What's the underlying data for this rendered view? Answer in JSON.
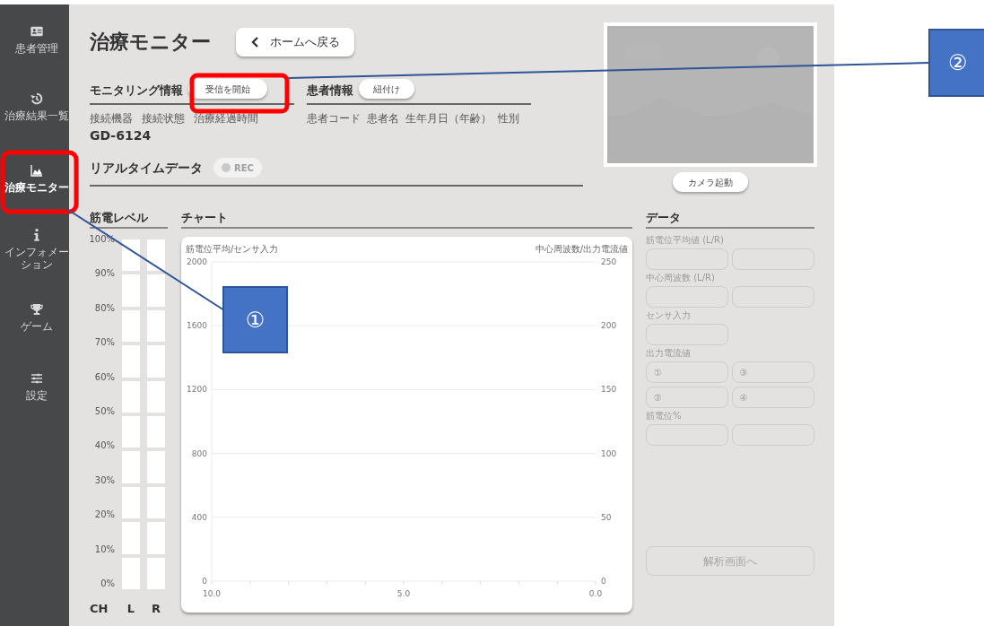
{
  "sidebar": {
    "items": [
      {
        "label": "患者管理",
        "selected": false
      },
      {
        "label": "治療結果一覧",
        "selected": false
      },
      {
        "label": "治療モニター",
        "selected": true
      },
      {
        "label": "インフォメーション",
        "selected": false
      },
      {
        "label": "ゲーム",
        "selected": false
      },
      {
        "label": "設定",
        "selected": false
      }
    ]
  },
  "header": {
    "title": "治療モニター",
    "back_button": "ホームへ戻る"
  },
  "monitoring": {
    "title": "モニタリング情報",
    "button": "受信を開始",
    "labels": [
      "接続機器",
      "接続状態",
      "治療経過時間"
    ],
    "device": "GD-6124"
  },
  "patient": {
    "title": "患者情報",
    "button": "紐付け",
    "labels": [
      "患者コード",
      "患者名",
      "生年月日（年齢）",
      "性別"
    ]
  },
  "realtime": {
    "title": "リアルタイムデータ",
    "rec_label": "REC",
    "recording": false
  },
  "camera": {
    "kind": "picture",
    "button": "カメラ起動"
  },
  "meter": {
    "title": "筋電レベル",
    "ticks": [
      "100%",
      "90%",
      "80%",
      "70%",
      "60%",
      "50%",
      "40%",
      "30%",
      "20%",
      "10%",
      "0%"
    ],
    "axis_label": "CH",
    "channels": [
      {
        "name": "L"
      },
      {
        "name": "R"
      }
    ]
  },
  "chart": {
    "title": "チャート",
    "right_axis": {
      "label": "中心周波数/出力電流値",
      "ticks": [
        "250",
        "200",
        "150",
        "100",
        "50",
        "0"
      ]
    },
    "chart_data": {
      "type": "line",
      "grid": true,
      "ylabel": "筋電位平均/センサ入力",
      "ylim": [
        0,
        2000
      ],
      "yticks": [
        0,
        400,
        800,
        1200,
        1600,
        2000
      ],
      "xlim": [
        10,
        0
      ],
      "xticks": [
        {
          "value": 10,
          "label": "10.0"
        },
        {
          "value": 5,
          "label": "5.0"
        },
        {
          "value": 0,
          "label": "0.0"
        }
      ]
    }
  },
  "data": {
    "title": "データ",
    "groups": [
      {
        "label": "筋電位平均値 (L/R)",
        "kind": "pair"
      },
      {
        "label": "中心周波数 (L/R)",
        "kind": "pair"
      },
      {
        "label": "センサ入力",
        "kind": "single"
      },
      {
        "label": "出力電流値",
        "kind": "quad",
        "placeholders": [
          "①",
          "③",
          "②",
          "④"
        ]
      },
      {
        "label": "筋電位%",
        "kind": "pair"
      }
    ],
    "button": "解析画面へ",
    "disabled": true
  },
  "annotations": [
    {
      "label": "①"
    },
    {
      "label": "②"
    }
  ]
}
